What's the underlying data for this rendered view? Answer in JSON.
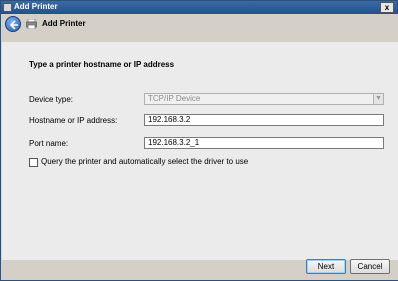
{
  "window": {
    "title": "Add Printer",
    "close_label": "x"
  },
  "header": {
    "title": "Add Printer"
  },
  "main": {
    "subtitle": "Type a printer hostname or IP address",
    "device_type": {
      "label": "Device type:",
      "value": "TCP/IP Device"
    },
    "hostname": {
      "label": "Hostname or IP address:",
      "value": "192.168.3.2"
    },
    "port_name": {
      "label": "Port name:",
      "value": "192.168.3.2_1"
    },
    "query_checkbox": {
      "label": "Query the printer and automatically select the driver to use",
      "checked": false
    }
  },
  "footer": {
    "next_label": "Next",
    "cancel_label": "Cancel"
  },
  "icons": {
    "back": "back-arrow-icon",
    "printer": "printer-icon",
    "dropdown": "chevron-down-icon"
  },
  "colors": {
    "titlebar": "#22508e",
    "panel": "#ebebeb",
    "chrome": "#d4d0c8"
  }
}
